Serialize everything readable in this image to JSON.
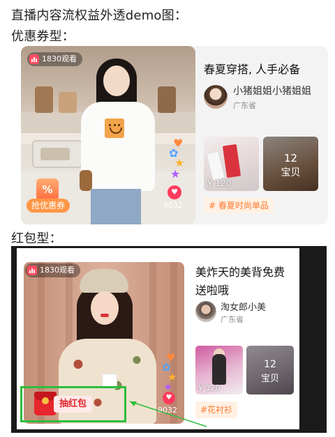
{
  "headings": {
    "main": "直播内容流权益外透demo图：",
    "coupon_type": "优惠券型：",
    "redpacket_type": "红包型："
  },
  "card_coupon": {
    "viewers": "1830观看",
    "likes": "9032",
    "coupon_button": "抢优惠券",
    "coupon_icon_glyph": "%",
    "title": "春夏穿搭, 人手必备",
    "shop_name": "小猪姐姐小猪姐姐",
    "location": "广东省",
    "product_price": "¥ 120",
    "more_count": "12",
    "more_label": "宝贝",
    "tag": "# 春夏时尚单品",
    "accent_color": "#ff7a2f"
  },
  "card_redpacket": {
    "viewers": "1830观看",
    "likes": "9032",
    "redpacket_button": "抽红包",
    "title": "美炸天的美背免费送啦哦",
    "shop_name": "淘女郎小美",
    "location": "广东省",
    "product_price": "¥ 120",
    "more_count": "12",
    "more_label": "宝贝",
    "tag": "#花衬衫",
    "highlight_color": "#2dbd3c"
  },
  "icons": {
    "live": "live-bars-icon",
    "heart": "heart-icon",
    "coupon": "coupon-icon",
    "red_packet": "red-packet-icon",
    "floating_gifts": "floating-gift-icons"
  }
}
